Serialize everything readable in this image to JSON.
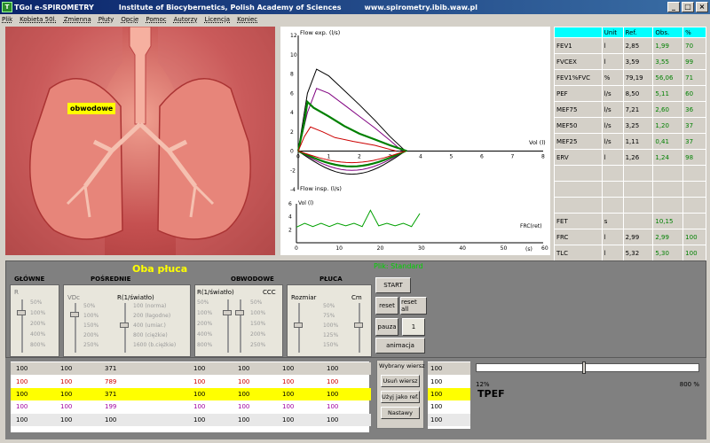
{
  "window": {
    "title": "TGol e-SPIROMETRY",
    "institute": "Institute of Biocybernetics, Polish Academy of Sciences",
    "url": "www.spirometry.ibib.waw.pl",
    "app_icon": "tgol-icon",
    "buttons": [
      "minimize",
      "maximize",
      "close"
    ]
  },
  "menu": [
    "Plik",
    "Kobieta 50l.",
    "Zmienna",
    "Płuty",
    "Opcje",
    "Pomoc",
    "Autorzy",
    "Licencja",
    "Koniec"
  ],
  "lung": {
    "label": "obwodowe"
  },
  "chart_data": [
    {
      "type": "line",
      "ylabel": "Flow exp. (l/s)",
      "ylabel2": "Flow insp. (l/s)",
      "xlabel": "Vol (l)",
      "xlim": [
        0,
        8
      ],
      "ylim": [
        -4,
        12
      ],
      "xticks": [
        0,
        1,
        2,
        3,
        4,
        5,
        6,
        7,
        8
      ],
      "yticks": [
        -4,
        -2,
        0,
        2,
        4,
        6,
        8,
        10,
        12
      ],
      "series": [
        {
          "color": "#000000",
          "x": [
            0,
            0.3,
            0.6,
            1,
            1.5,
            2,
            2.5,
            3,
            3.5
          ],
          "y": [
            0,
            6,
            8.5,
            7.8,
            6.3,
            4.8,
            3.2,
            1.5,
            0
          ]
        },
        {
          "color": "#800080",
          "x": [
            0,
            0.3,
            0.6,
            1,
            1.5,
            2,
            2.5,
            3,
            3.4
          ],
          "y": [
            0,
            4,
            6.5,
            6,
            4.8,
            3.6,
            2.4,
            1.1,
            0
          ]
        },
        {
          "color": "#008000",
          "x": [
            0,
            0.2,
            0.3,
            0.5,
            1,
            1.5,
            2,
            2.5,
            3,
            3.55
          ],
          "y": [
            0,
            3,
            5.1,
            4.5,
            3.6,
            2.6,
            1.8,
            1.2,
            0.6,
            0
          ]
        },
        {
          "color": "#cc0000",
          "x": [
            0,
            0.2,
            0.4,
            0.8,
            1.2,
            1.8,
            2.5,
            3.2
          ],
          "y": [
            0,
            1.5,
            2.5,
            2,
            1.4,
            1,
            0.6,
            0
          ]
        }
      ]
    },
    {
      "type": "line",
      "ylabel": "Vol (l)",
      "xlabel": "(s)",
      "annotation": "FRC(ret)",
      "xlim": [
        0,
        60
      ],
      "ylim": [
        0,
        6
      ],
      "xticks": [
        0,
        10,
        20,
        30,
        40,
        50,
        60
      ],
      "yticks": [
        2,
        4,
        6
      ],
      "series": [
        {
          "color": "#00a000",
          "x": [
            0,
            2,
            4,
            6,
            8,
            10,
            12,
            14,
            16,
            18,
            20,
            22,
            24,
            26,
            28,
            30
          ],
          "y": [
            2.4,
            3,
            2.5,
            3,
            2.5,
            3,
            2.6,
            3,
            2.5,
            5,
            2.6,
            3,
            2.6,
            3,
            2.5,
            4.5
          ]
        }
      ]
    }
  ],
  "table": {
    "headers": [
      "",
      "Unit",
      "Ref.",
      "Obs.",
      "%"
    ],
    "rows": [
      [
        "FEV1",
        "l",
        "2,85",
        "1,99",
        "70"
      ],
      [
        "FVCEX",
        "l",
        "3,59",
        "3,55",
        "99"
      ],
      [
        "FEV1%FVC",
        "%",
        "79,19",
        "56,06",
        "71"
      ],
      [
        "PEF",
        "l/s",
        "8,50",
        "5,11",
        "60"
      ],
      [
        "MEF75",
        "l/s",
        "7,21",
        "2,60",
        "36"
      ],
      [
        "MEF50",
        "l/s",
        "3,25",
        "1,20",
        "37"
      ],
      [
        "MEF25",
        "l/s",
        "1,11",
        "0,41",
        "37"
      ],
      [
        "ERV",
        "l",
        "1,26",
        "1,24",
        "98"
      ],
      [
        "",
        "",
        "",
        "",
        ""
      ],
      [
        "",
        "",
        "",
        "",
        ""
      ],
      [
        "",
        "",
        "",
        "",
        ""
      ],
      [
        "FET",
        "s",
        "",
        "10,15",
        ""
      ],
      [
        "FRC",
        "l",
        "2,99",
        "2,99",
        "100"
      ],
      [
        "TLC",
        "l",
        "5,32",
        "5,30",
        "100"
      ]
    ]
  },
  "controls": {
    "title": "Oba płuca",
    "plik": "Plik: Standard",
    "groups": {
      "glowne": "GŁÓWNE",
      "posrednie": "POŚREDNIE",
      "obwodowe": "OBWODOWE",
      "pluca": "PŁUCA"
    },
    "sliders": {
      "r": "R",
      "vdc": "VDc",
      "ri": "R(1/światło)",
      "ri2": "R(1/światło)",
      "ccc": "CCC",
      "rozmiar": "Rozmiar",
      "cm": "Cm"
    },
    "ticks_pct": [
      "50%",
      "100%",
      "200%",
      "400%",
      "800%"
    ],
    "ticks_vdc": [
      "50%",
      "100%",
      "150%",
      "200%",
      "250%"
    ],
    "ticks_ri": [
      "100 (norma)",
      "200 (łagodne)",
      "400 (umiar.)",
      "800 (ciężkie)",
      "1600 (b.ciężkie)"
    ],
    "ticks_obw": [
      "50%",
      "100%",
      "200%",
      "400%",
      "800%"
    ],
    "ticks_ccc": [
      "50%",
      "100%",
      "150%",
      "200%",
      "250%"
    ],
    "ticks_rozm": [
      "50%",
      "75%",
      "100%",
      "125%",
      "150%"
    ],
    "buttons": {
      "start": "START",
      "reset": "reset",
      "reset_all": "reset all",
      "pauza": "pauza",
      "count": "1",
      "animacja": "animacja"
    }
  },
  "grid": {
    "rows": [
      {
        "cells": [
          "100",
          "100",
          "371",
          "",
          "100",
          "100",
          "100",
          "100"
        ]
      },
      {
        "cells": [
          "100",
          "100",
          "789",
          "",
          "100",
          "100",
          "100",
          "100"
        ]
      },
      {
        "cells": [
          "100",
          "100",
          "371",
          "",
          "100",
          "100",
          "100",
          "100"
        ]
      },
      {
        "cells": [
          "100",
          "100",
          "199",
          "",
          "100",
          "100",
          "100",
          "100"
        ]
      },
      {
        "cells": [
          "100",
          "100",
          "100",
          "",
          "100",
          "100",
          "100",
          "100"
        ]
      }
    ],
    "side": [
      "100",
      "100",
      "100",
      "100",
      "100"
    ]
  },
  "selected": {
    "title": "Wybrany wiersz",
    "usun": "Usuń wiersz",
    "uzyj": "Użyj jako ref.",
    "nastawy": "Nastawy"
  },
  "tpef": {
    "label": "TPEF",
    "min": "12%",
    "max": "800 %",
    "value_pct": 12
  }
}
